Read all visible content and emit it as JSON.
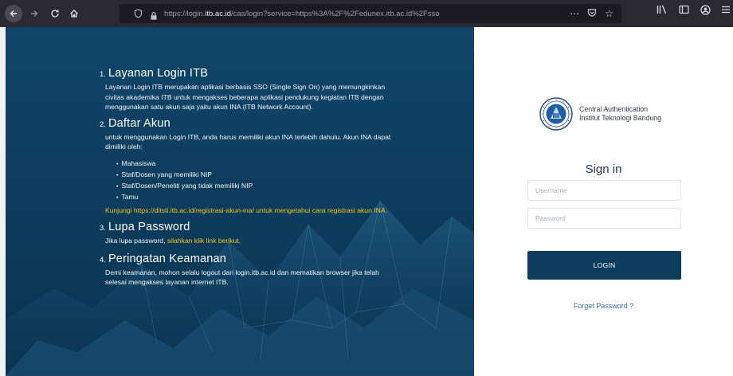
{
  "browser": {
    "url_prefix": "https://login.",
    "url_domain": "itb.ac.id",
    "url_suffix": "/cas/login?service=https%3A%2F%2Fedunex.itb.ac.id%2Fsso",
    "icons": [
      "back-icon",
      "forward-icon",
      "reload-icon",
      "home-icon",
      "shield-icon",
      "lock-icon",
      "more-icon",
      "pocket-icon",
      "star-icon",
      "library-icon",
      "sidebar-icon",
      "account-icon",
      "menu-icon"
    ]
  },
  "info": {
    "sections": [
      {
        "num": "1.",
        "title": "Layanan Login ITB",
        "body": "Layanan Login ITB merupakan aplikasi berbasis SSO (Single Sign On) yang memungkinkan civitas akademika ITB untuk mengakses beberapa aplikasi pendukung kegiatan ITB dengan menggunakan satu akun saja yaitu akun INA (ITB Network Account)."
      },
      {
        "num": "2.",
        "title": "Daftar Akun",
        "body": "untuk menggunakan Login ITB, anda harus memiliki akun INA terlebih dahulu. Akun INA dapat dimiliki oleh:",
        "bullets": [
          "Mahasiswa",
          "Staf/Dosen yang memiliki NIP",
          "Staf/Dosen/Peneliti yang tidak memiliki NIP",
          "Tamu"
        ],
        "link": "Kunjungi https://ditsti.itb.ac.id/registrasi-akun-ina/ untuk mengetahui cara registrasi akun INA."
      },
      {
        "num": "3.",
        "title": "Lupa Password",
        "body_prefix": "Jika lupa password, ",
        "link": "silahkan klik link berikut."
      },
      {
        "num": "4.",
        "title": "Peringatan Keamanan",
        "body": "Demi keamanan, mohon selalu logout dari login.itb.ac.id dan mematikan browser jika telah selesai mengakses layanan internet ITB."
      }
    ]
  },
  "login": {
    "brand_line1": "Central Authentication",
    "brand_line2": "Institut Teknologi Bandung",
    "title": "Sign in",
    "username_placeholder": "Username",
    "password_placeholder": "Password",
    "button_label": "LOGIN",
    "forget_label": "Forget Password ?"
  },
  "colors": {
    "panel_bg": "#0d3d5d",
    "accent_yellow": "#f5c518",
    "button_bg": "#0d3d5d",
    "link_blue": "#2f6fa8"
  }
}
